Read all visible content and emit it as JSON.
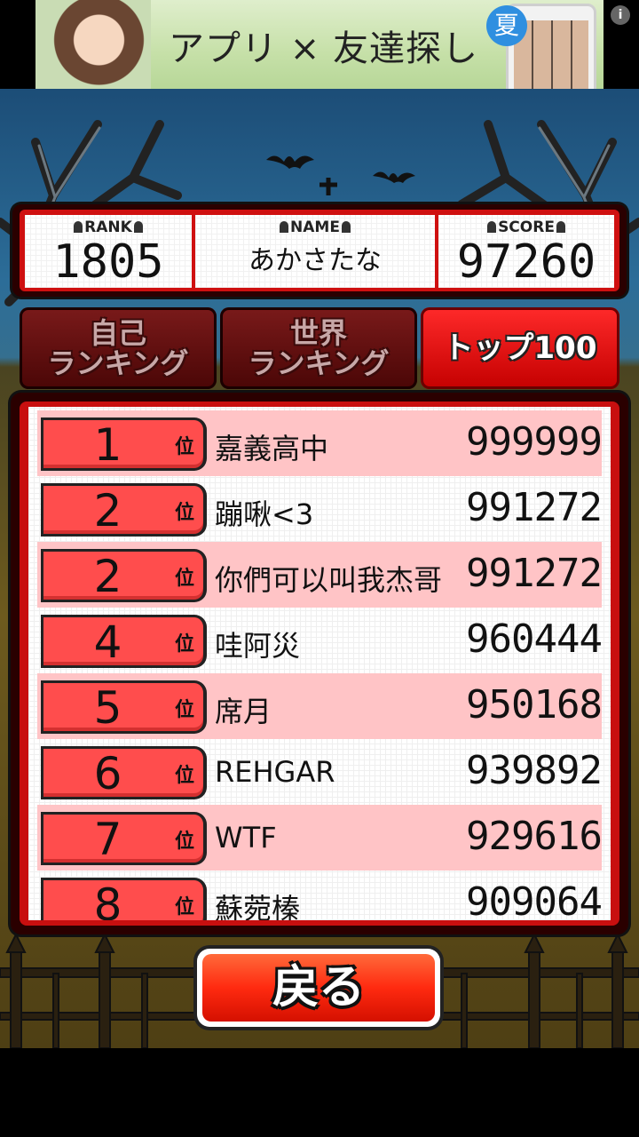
{
  "ad": {
    "text": "アプリ × 友達探し",
    "bubble": "夏",
    "info": "i"
  },
  "status": {
    "rank_label": "RANK",
    "rank_value": "1805",
    "name_label": "NAME",
    "name_value": "あかさたな",
    "score_label": "SCORE",
    "score_value": "97260"
  },
  "tabs": [
    {
      "label": "自己\nランキング",
      "active": false
    },
    {
      "label": "世界\nランキング",
      "active": false
    },
    {
      "label": "トップ100",
      "active": true
    }
  ],
  "position_suffix": "位",
  "rankings": [
    {
      "rank": "1",
      "name": "嘉義高中",
      "score": "999999"
    },
    {
      "rank": "2",
      "name": "蹦啾<3",
      "score": "991272"
    },
    {
      "rank": "2",
      "name": "你們可以叫我杰哥",
      "score": "991272"
    },
    {
      "rank": "4",
      "name": "哇阿災",
      "score": "960444"
    },
    {
      "rank": "5",
      "name": "席月",
      "score": "950168"
    },
    {
      "rank": "6",
      "name": "REHGAR",
      "score": "939892"
    },
    {
      "rank": "7",
      "name": "WTF",
      "score": "929616"
    },
    {
      "rank": "8",
      "name": "蘇菀榛",
      "score": "909064"
    }
  ],
  "back_button": "戻る",
  "colors": {
    "panel_red": "#c80f0f",
    "row_pink": "#ffc4c6",
    "badge_red": "#ff4d4d",
    "sky": "#1c4d77"
  }
}
